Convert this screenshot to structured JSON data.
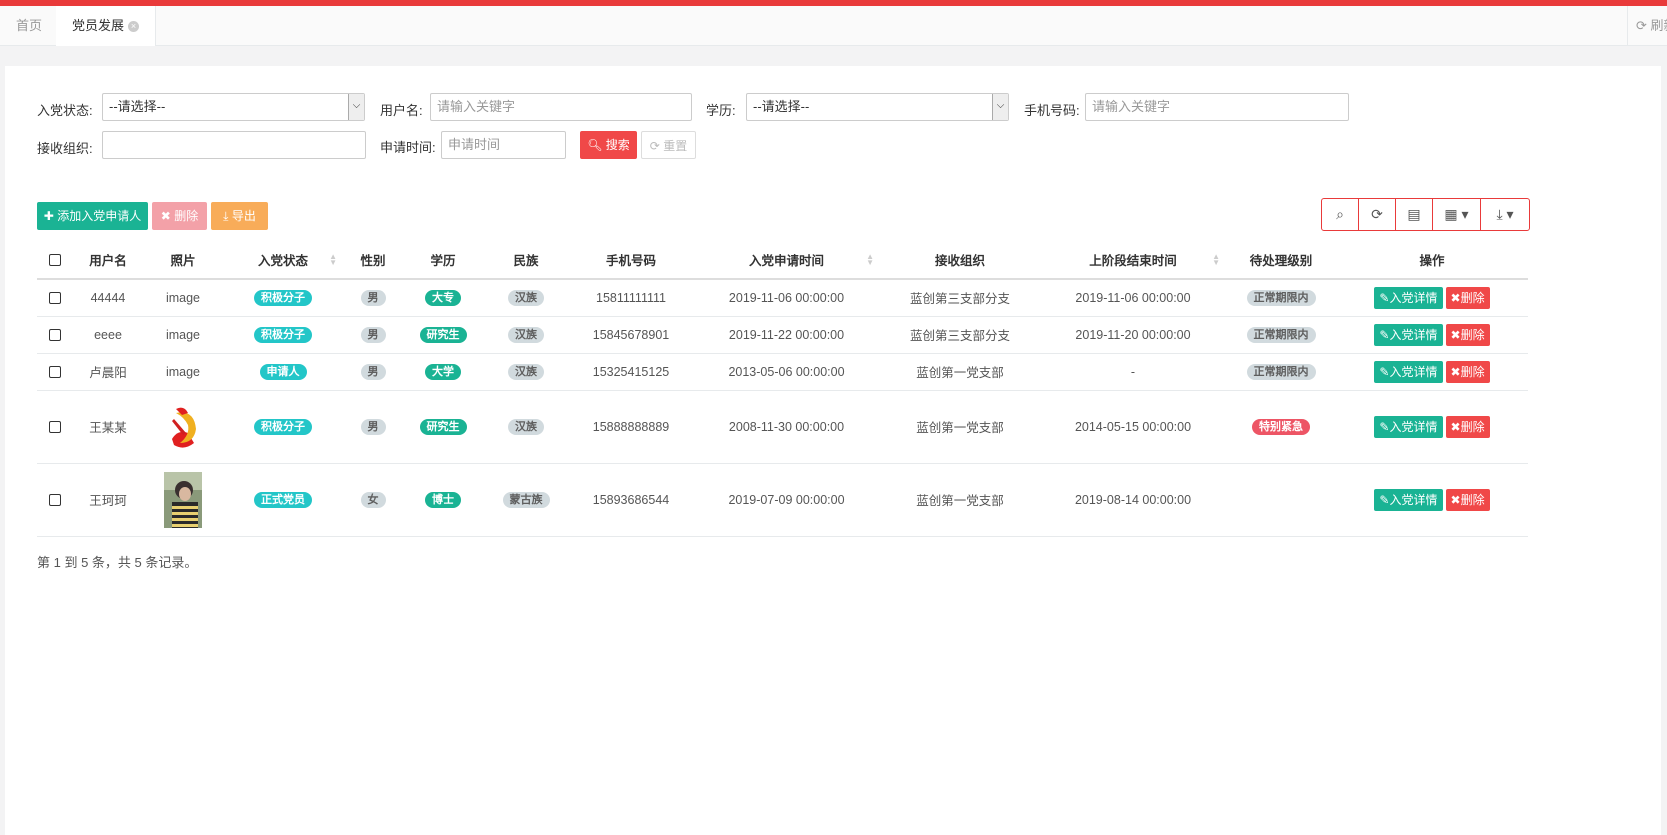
{
  "tabs": {
    "home": "首页",
    "active": "党员发展",
    "refresh": "刷新"
  },
  "form": {
    "status_label": "入党状态:",
    "status_value": "--请选择--",
    "username_label": "用户名:",
    "username_placeholder": "请输入关键字",
    "edu_label": "学历:",
    "edu_value": "--请选择--",
    "phone_label": "手机号码:",
    "phone_placeholder": "请输入关键字",
    "org_label": "接收组织:",
    "apply_time_label": "申请时间:",
    "apply_time_placeholder": "申请时间",
    "search_btn": "搜索",
    "reset_btn": "重置"
  },
  "toolbar": {
    "add_btn": "添加入党申请人",
    "delete_btn": "删除",
    "export_btn": "导出"
  },
  "columns": [
    "用户名",
    "照片",
    "入党状态",
    "性别",
    "学历",
    "民族",
    "手机号码",
    "入党申请时间",
    "接收组织",
    "上阶段结束时间",
    "待处理级别",
    "操作"
  ],
  "rows": [
    {
      "username": "44444",
      "photo": "image",
      "status": "积极分子",
      "gender": "男",
      "edu": "大专",
      "nation": "汉族",
      "phone": "15811111111",
      "apply_time": "2019-11-06 00:00:00",
      "org": "蓝创第三支部分支",
      "stage_end": "2019-11-06 00:00:00",
      "level": "正常期限内",
      "detail": "入党详情",
      "del": "删除"
    },
    {
      "username": "eeee",
      "photo": "image",
      "status": "积极分子",
      "gender": "男",
      "edu": "研究生",
      "nation": "汉族",
      "phone": "15845678901",
      "apply_time": "2019-11-22 00:00:00",
      "org": "蓝创第三支部分支",
      "stage_end": "2019-11-20 00:00:00",
      "level": "正常期限内",
      "detail": "入党详情",
      "del": "删除"
    },
    {
      "username": "卢晨阳",
      "photo": "image",
      "status": "申请人",
      "gender": "男",
      "edu": "大学",
      "nation": "汉族",
      "phone": "15325415125",
      "apply_time": "2013-05-06 00:00:00",
      "org": "蓝创第一党支部",
      "stage_end": "-",
      "level": "正常期限内",
      "detail": "入党详情",
      "del": "删除"
    },
    {
      "username": "王某某",
      "photo": "",
      "status": "积极分子",
      "gender": "男",
      "edu": "研究生",
      "nation": "汉族",
      "phone": "15888888889",
      "apply_time": "2008-11-30 00:00:00",
      "org": "蓝创第一党支部",
      "stage_end": "2014-05-15 00:00:00",
      "level": "特别紧急",
      "detail": "入党详情",
      "del": "删除"
    },
    {
      "username": "王珂珂",
      "photo": "",
      "status": "正式党员",
      "gender": "女",
      "edu": "博士",
      "nation": "蒙古族",
      "phone": "15893686544",
      "apply_time": "2019-07-09 00:00:00",
      "org": "蓝创第一党支部",
      "stage_end": "2019-08-14 00:00:00",
      "level": "",
      "detail": "入党详情",
      "del": "删除"
    }
  ],
  "pagination_text": "第 1 到 5 条，共 5 条记录。",
  "colors": {
    "accent_red": "#e93a3a",
    "green": "#1ab394",
    "cyan": "#23c6c8",
    "orange": "#f8ac59"
  }
}
